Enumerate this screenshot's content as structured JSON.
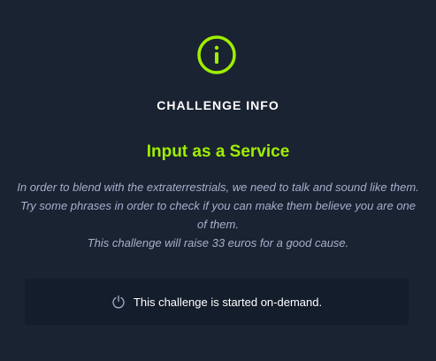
{
  "modal": {
    "heading": "CHALLENGE INFO",
    "title": "Input as a Service",
    "description_lines": [
      "In order to blend with the extraterrestrials, we need to talk and sound like them. Try some phrases in order to check if you can make them believe you are one of them.",
      "This challenge will raise 33 euros for a good cause."
    ],
    "ondemand_text": "This challenge is started on-demand.",
    "icons": {
      "info": "info-icon",
      "power": "power-icon"
    },
    "colors": {
      "background": "#1a2332",
      "accent": "#9fef00",
      "muted_text": "#a4b1cd",
      "box_background": "#141d2b"
    }
  }
}
